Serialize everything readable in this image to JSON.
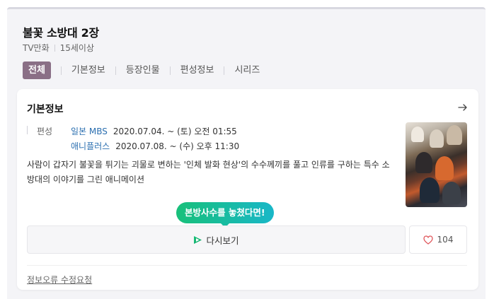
{
  "program": {
    "title": "불꽃 소방대 2장",
    "genre": "TV만화",
    "rating": "15세이상"
  },
  "tabs": [
    {
      "label": "전체",
      "active": true
    },
    {
      "label": "기본정보",
      "active": false
    },
    {
      "label": "등장인물",
      "active": false
    },
    {
      "label": "편성정보",
      "active": false
    },
    {
      "label": "시리즈",
      "active": false
    }
  ],
  "basic_info": {
    "section_title": "기본정보",
    "broadcast_label": "편성",
    "broadcasts": [
      {
        "channel": "일본 MBS",
        "schedule": "2020.07.04. ~  (토) 오전 01:55"
      },
      {
        "channel": "애니플러스",
        "schedule": "2020.07.08. ~  (수) 오후 11:30"
      }
    ],
    "synopsis": "사람이 갑자기 불꽃을 튀기는 괴물로 변하는 '인체 발화 현상'의 수수께끼를 풀고 인류를 구하는 특수 소방대의 이야기를 그린 애니메이션",
    "poster_icon": "poster-image"
  },
  "actions": {
    "tooltip": "본방사수를 놓쳤다면!",
    "replay_label": "다시보기",
    "replay_icon": "play-icon",
    "like_count": "104",
    "like_icon": "heart-icon"
  },
  "footer": {
    "report_link": "정보오류 수정요청"
  },
  "colors": {
    "active_tab": "#8a6f86",
    "channel_link": "#2b6fb0",
    "tooltip_start": "#18c07a",
    "tooltip_end": "#19b7c8",
    "heart": "#e0565b"
  }
}
